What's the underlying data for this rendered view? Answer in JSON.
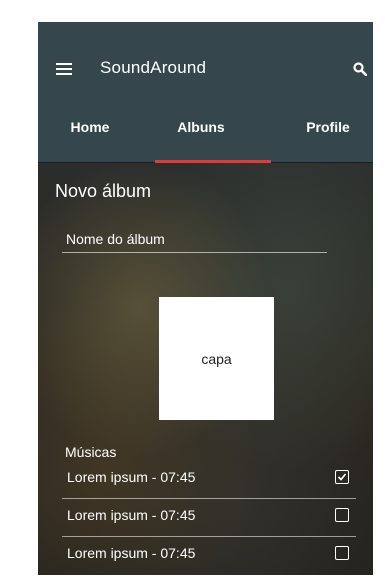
{
  "app": {
    "title": "SoundAround",
    "icons": {
      "menu": "menu-icon",
      "search": "search-icon"
    }
  },
  "tabs": [
    {
      "label": "Home",
      "active": false
    },
    {
      "label": "Albuns",
      "active": true
    },
    {
      "label": "Profile",
      "active": false
    }
  ],
  "colors": {
    "appbar": "#35464d",
    "accent": "#e53935"
  },
  "form": {
    "section_title": "Novo álbum",
    "album_name_placeholder": "Nome do álbum",
    "cover_label": "capa",
    "songs_label": "Músicas"
  },
  "songs": [
    {
      "label": "Lorem ipsum - 07:45",
      "checked": true
    },
    {
      "label": "Lorem ipsum - 07:45",
      "checked": false
    },
    {
      "label": "Lorem ipsum - 07:45",
      "checked": false
    }
  ]
}
